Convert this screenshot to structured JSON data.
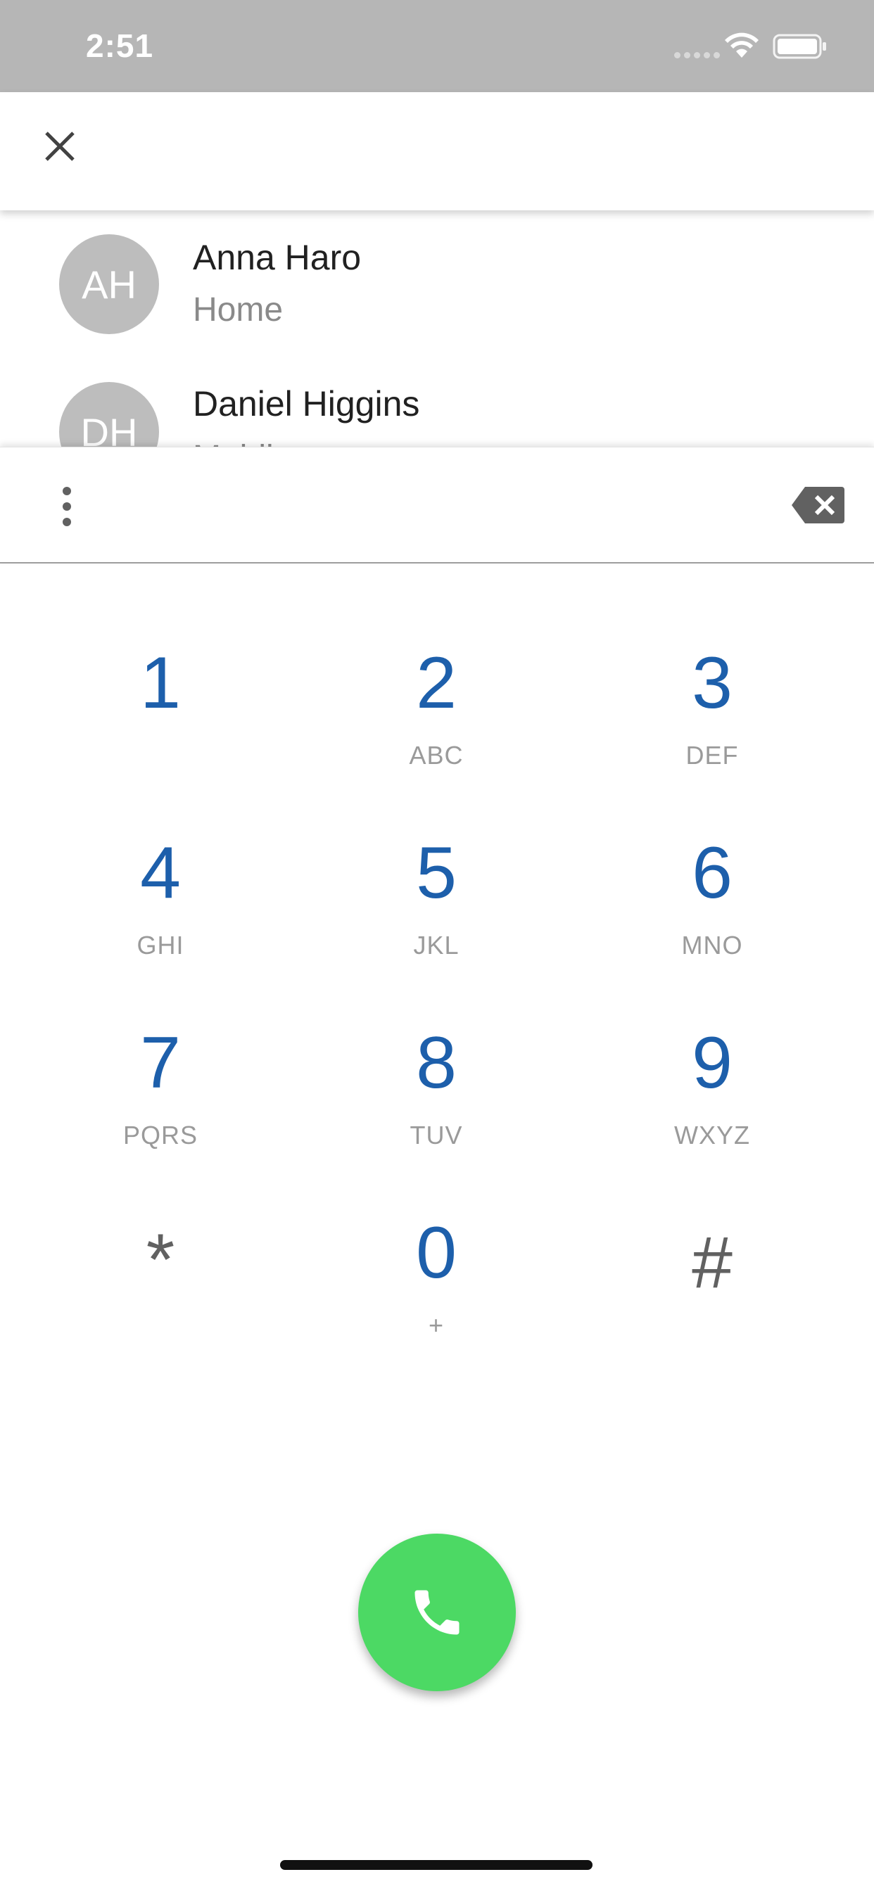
{
  "status_bar": {
    "time": "2:51"
  },
  "contacts": [
    {
      "initials": "AH",
      "name": "Anna Haro",
      "type": "Home"
    },
    {
      "initials": "DH",
      "name": "Daniel Higgins",
      "type": "Mobile"
    }
  ],
  "dialer": {
    "number": "",
    "keys": [
      {
        "digit": "1",
        "letters": ""
      },
      {
        "digit": "2",
        "letters": "ABC"
      },
      {
        "digit": "3",
        "letters": "DEF"
      },
      {
        "digit": "4",
        "letters": "GHI"
      },
      {
        "digit": "5",
        "letters": "JKL"
      },
      {
        "digit": "6",
        "letters": "MNO"
      },
      {
        "digit": "7",
        "letters": "PQRS"
      },
      {
        "digit": "8",
        "letters": "TUV"
      },
      {
        "digit": "9",
        "letters": "WXYZ"
      },
      {
        "digit": "*",
        "letters": ""
      },
      {
        "digit": "0",
        "letters": "+"
      },
      {
        "digit": "#",
        "letters": ""
      }
    ]
  },
  "icons": {
    "close": "close-icon",
    "more": "more-vert-icon",
    "backspace": "backspace-icon",
    "call": "phone-icon"
  },
  "colors": {
    "status_bar": "#b6b6b6",
    "digit": "#1d5fab",
    "letters": "#9a9a9a",
    "avatar": "#bdbdbd",
    "call_button": "#4cd964"
  }
}
